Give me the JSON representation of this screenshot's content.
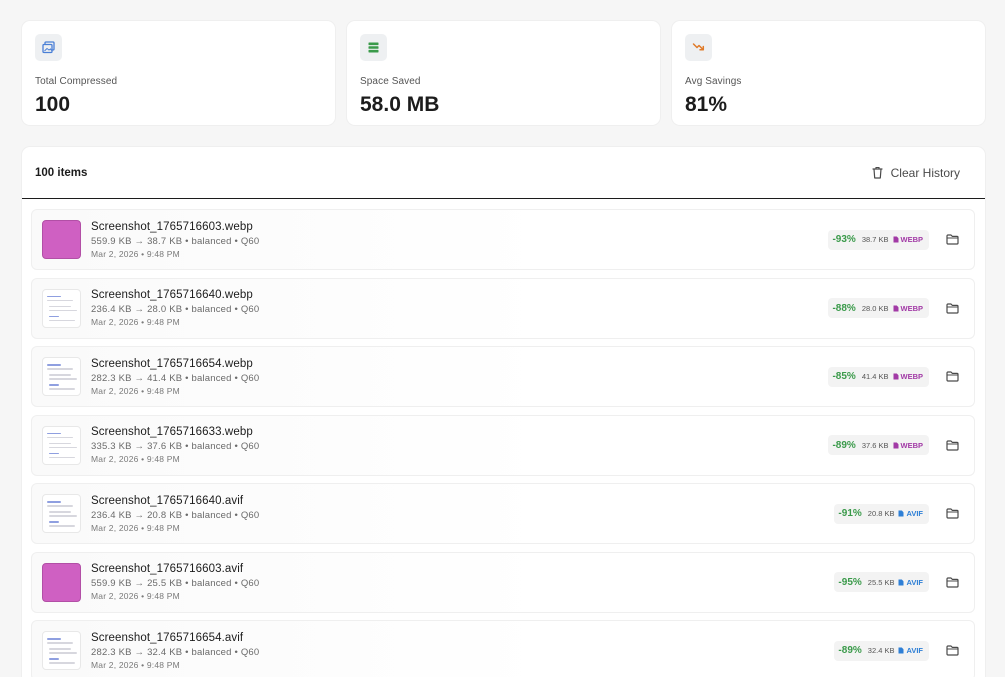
{
  "stats": [
    {
      "icon": "image-stack-icon",
      "label": "Total Compressed",
      "value": "100",
      "color": "#4a7fd6"
    },
    {
      "icon": "database-icon",
      "label": "Space Saved",
      "value": "58.0 MB",
      "color": "#3a9a4a"
    },
    {
      "icon": "trending-down-icon",
      "label": "Avg Savings",
      "value": "81%",
      "color": "#e07b2a"
    }
  ],
  "list": {
    "count_label": "100 items",
    "clear_label": "Clear History"
  },
  "items": [
    {
      "name": "Screenshot_1765716603.webp",
      "meta": "559.9 KB → 38.7 KB • balanced • Q60",
      "date": "Mar 2, 2026 • 9:48 PM",
      "percent": "-93%",
      "size": "38.7 KB",
      "format": "WEBP",
      "thumb": "pink"
    },
    {
      "name": "Screenshot_1765716640.webp",
      "meta": "236.4 KB → 28.0 KB • balanced • Q60",
      "date": "Mar 2, 2026 • 9:48 PM",
      "percent": "-88%",
      "size": "28.0 KB",
      "format": "WEBP",
      "thumb": "doc"
    },
    {
      "name": "Screenshot_1765716654.webp",
      "meta": "282.3 KB → 41.4 KB • balanced • Q60",
      "date": "Mar 2, 2026 • 9:48 PM",
      "percent": "-85%",
      "size": "41.4 KB",
      "format": "WEBP",
      "thumb": "doc"
    },
    {
      "name": "Screenshot_1765716633.webp",
      "meta": "335.3 KB → 37.6 KB • balanced • Q60",
      "date": "Mar 2, 2026 • 9:48 PM",
      "percent": "-89%",
      "size": "37.6 KB",
      "format": "WEBP",
      "thumb": "doc"
    },
    {
      "name": "Screenshot_1765716640.avif",
      "meta": "236.4 KB → 20.8 KB • balanced • Q60",
      "date": "Mar 2, 2026 • 9:48 PM",
      "percent": "-91%",
      "size": "20.8 KB",
      "format": "AVIF",
      "thumb": "doc"
    },
    {
      "name": "Screenshot_1765716603.avif",
      "meta": "559.9 KB → 25.5 KB • balanced • Q60",
      "date": "Mar 2, 2026 • 9:48 PM",
      "percent": "-95%",
      "size": "25.5 KB",
      "format": "AVIF",
      "thumb": "pink"
    },
    {
      "name": "Screenshot_1765716654.avif",
      "meta": "282.3 KB → 32.4 KB • balanced • Q60",
      "date": "Mar 2, 2026 • 9:48 PM",
      "percent": "-89%",
      "size": "32.4 KB",
      "format": "AVIF",
      "thumb": "doc"
    }
  ]
}
